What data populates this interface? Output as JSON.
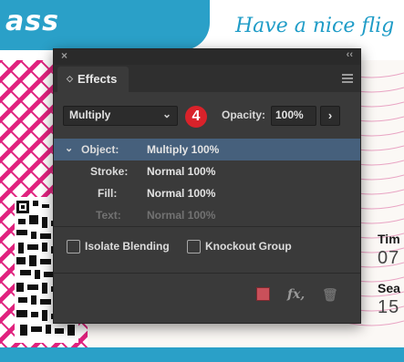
{
  "document": {
    "title_left": "ass",
    "title_right": "Have a nice flig",
    "time_label": "Tim",
    "time_value": "07",
    "seat_label": "Sea",
    "seat_value": "15"
  },
  "panel": {
    "close_glyph": "×",
    "collapse_glyph": "‹‹",
    "tab_icon": "◇",
    "tab_label": "Effects",
    "blend_mode": "Multiply",
    "badge_number": "4",
    "opacity_label": "Opacity:",
    "opacity_value": "100%",
    "rows": [
      {
        "label": "Object:",
        "value": "Multiply 100%",
        "selected": true
      },
      {
        "label": "Stroke:",
        "value": "Normal 100%"
      },
      {
        "label": "Fill:",
        "value": "Normal 100%"
      },
      {
        "label": "Text:",
        "value": "Normal 100%",
        "disabled": true
      }
    ],
    "isolate_label": "Isolate Blending",
    "knockout_label": "Knockout Group",
    "icons": {
      "menu": "panel-menu-icon",
      "chevron_down": "chevron-down-icon",
      "chevron_right": "chevron-right-icon",
      "clear": "clear-effects-icon",
      "fx": "fx-icon",
      "trash": "trash-icon"
    },
    "colors": {
      "badge": "#d9222a",
      "selected_row": "#46607c",
      "panel_bg": "#3a3a3a",
      "accent": "#2aa0c8"
    }
  }
}
